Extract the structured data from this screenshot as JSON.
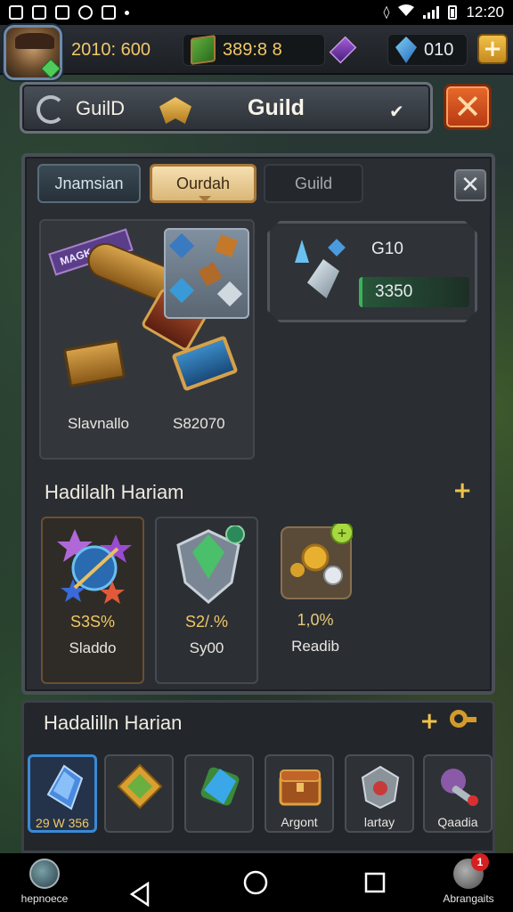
{
  "status_bar": {
    "time": "12:20",
    "icons": [
      "gallery-icon",
      "image-icon",
      "clipboard-icon",
      "google-icon",
      "screenshot-icon",
      "dot-icon",
      "vibrate-icon",
      "wifi-icon",
      "signal-icon",
      "battery-icon"
    ]
  },
  "resources": {
    "gold": "2010: 600",
    "books": "389:8 8",
    "gems": "010",
    "plus_label": "+"
  },
  "header": {
    "left_label": "GuilD",
    "title": "Guild",
    "check": "✔",
    "close_label": "✕"
  },
  "tabs": [
    {
      "label": "Jnamsian"
    },
    {
      "label": "Ourdah"
    },
    {
      "label": "Guild"
    }
  ],
  "tabs_close_label": "✕",
  "items_card": {
    "ribbon_text": "MAGK",
    "left_label": "Slavnallo",
    "right_label": "S82070"
  },
  "stats_card": {
    "value_a": "G10",
    "value_b": "3350"
  },
  "section1": {
    "title": "Hadilalh Hariam",
    "plus": "+",
    "perks": [
      {
        "value": "S3S%",
        "name": "Sladdo"
      },
      {
        "value": "S2/.%",
        "name": "Sy00"
      },
      {
        "value": "1,0%",
        "name": "Readib"
      }
    ]
  },
  "section2": {
    "title": "Hadalilln Harian",
    "plus": "+",
    "slots": [
      {
        "label": "29 W 356"
      },
      {
        "label": ""
      },
      {
        "label": ""
      },
      {
        "label": "Argont"
      },
      {
        "label": "lartay"
      },
      {
        "label": "Qaadia"
      }
    ]
  },
  "nav": {
    "left_label": "hepnoece",
    "right_label": "Abrangaits",
    "badge": "1"
  },
  "colors": {
    "accent_gold": "#f1c86a",
    "close_orange": "#e86a2c",
    "tab_active": "#d9b778",
    "highlight_blue": "#3a8ad6"
  }
}
